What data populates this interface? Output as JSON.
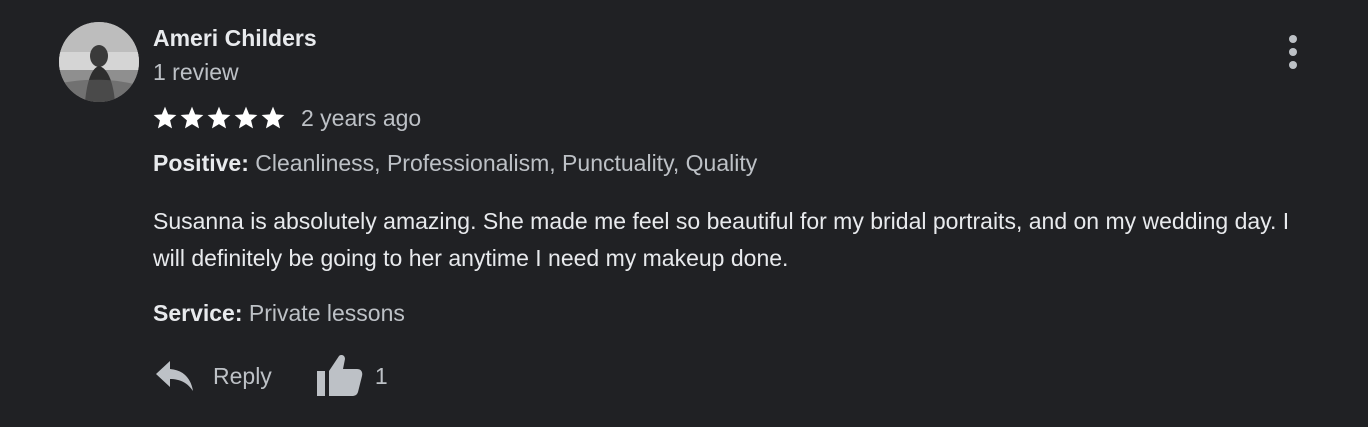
{
  "review": {
    "author": {
      "name": "Ameri Childers",
      "meta": "1 review"
    },
    "rating": {
      "stars": 5,
      "max": 5
    },
    "date": "2 years ago",
    "positive": {
      "label": "Positive:",
      "value": "Cleanliness, Professionalism, Punctuality, Quality"
    },
    "text": "Susanna is absolutely amazing. She made me feel so beautiful for my bridal portraits, and on my wedding day. I will definitely be going to her anytime I need my makeup done.",
    "service": {
      "label": "Service:",
      "value": "Private lessons"
    },
    "actions": {
      "reply_label": "Reply",
      "like_count": "1"
    }
  },
  "icons": {
    "more": "more-vert-icon",
    "star": "star-icon",
    "reply": "reply-icon",
    "like": "thumbs-up-icon"
  },
  "colors": {
    "background": "#202124",
    "text_primary": "#e8eaed",
    "text_secondary": "#bdc1c6",
    "star": "#ffffff"
  }
}
